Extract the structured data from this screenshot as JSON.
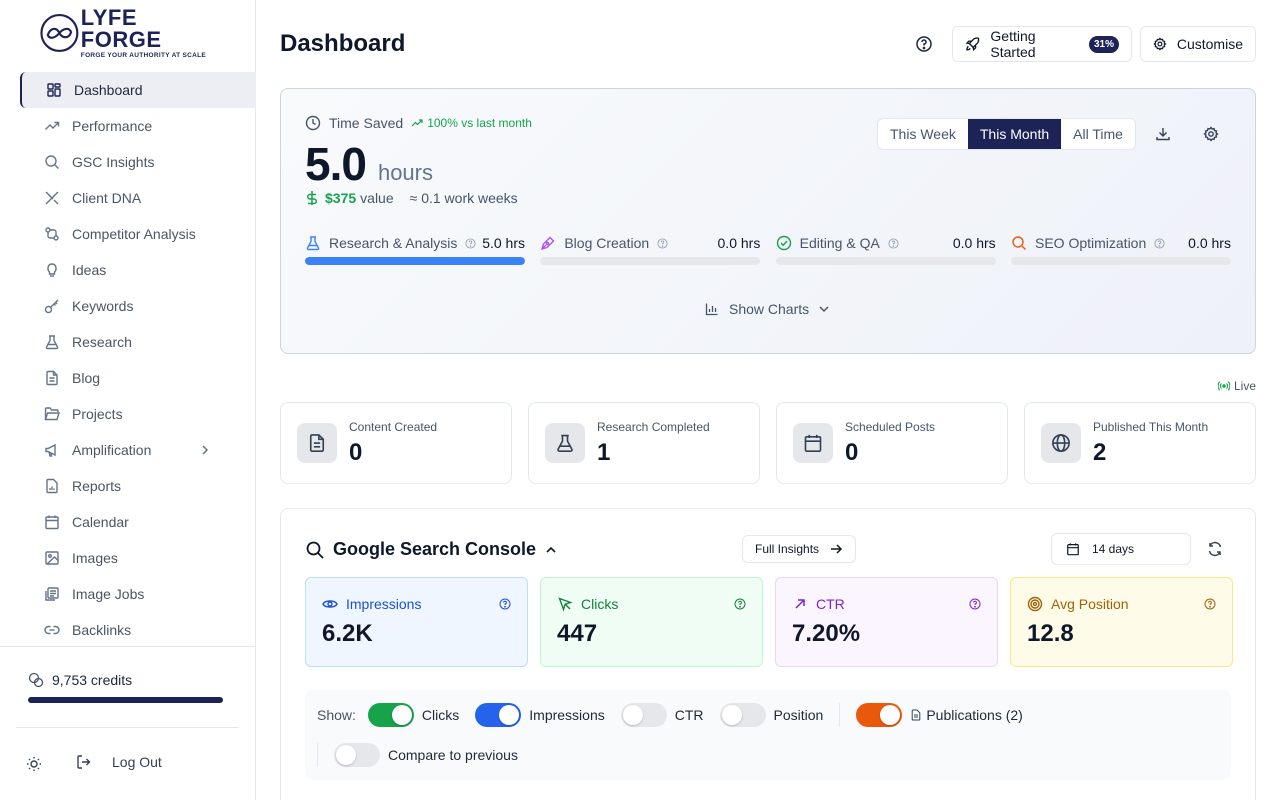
{
  "brand": {
    "name": "LYFE FORGE",
    "tagline": "FORGE YOUR AUTHORITY AT SCALE"
  },
  "sidebar": {
    "items": [
      {
        "label": "Dashboard",
        "icon": "dashboard-icon",
        "active": true
      },
      {
        "label": "Performance",
        "icon": "trend-icon"
      },
      {
        "label": "GSC Insights",
        "icon": "search-icon"
      },
      {
        "label": "Client DNA",
        "icon": "dna-icon"
      },
      {
        "label": "Competitor Analysis",
        "icon": "network-icon"
      },
      {
        "label": "Ideas",
        "icon": "lightbulb-icon"
      },
      {
        "label": "Keywords",
        "icon": "key-icon"
      },
      {
        "label": "Research",
        "icon": "flask-icon"
      },
      {
        "label": "Blog",
        "icon": "document-icon"
      },
      {
        "label": "Projects",
        "icon": "folder-icon"
      },
      {
        "label": "Amplification",
        "icon": "megaphone-icon",
        "has_submenu": true
      },
      {
        "label": "Reports",
        "icon": "report-icon"
      },
      {
        "label": "Calendar",
        "icon": "calendar-icon"
      },
      {
        "label": "Images",
        "icon": "image-icon"
      },
      {
        "label": "Image Jobs",
        "icon": "image-jobs-icon"
      },
      {
        "label": "Backlinks",
        "icon": "link-icon"
      }
    ],
    "credits_label": "9,753 credits",
    "credits_fill": 1.0,
    "logout_label": "Log Out"
  },
  "header": {
    "title": "Dashboard",
    "getting_started_label": "Getting Started",
    "getting_started_badge": "31%",
    "customise_label": "Customise"
  },
  "time_saved": {
    "label": "Time Saved",
    "trend": "100% vs last month",
    "value": "5.0",
    "unit": "hours",
    "money": "$375",
    "money_suffix": "value",
    "weeks": "≈ 0.1 work weeks",
    "periods": [
      "This Week",
      "This Month",
      "All Time"
    ],
    "active_period": "This Month",
    "categories": [
      {
        "label": "Research & Analysis",
        "value": "5.0 hrs",
        "fill": 1.0,
        "icon": "flask-icon",
        "color": "#3b82f6"
      },
      {
        "label": "Blog Creation",
        "value": "0.0 hrs",
        "fill": 0,
        "icon": "pen-icon",
        "color": "#a855f7"
      },
      {
        "label": "Editing & QA",
        "value": "0.0 hrs",
        "fill": 0,
        "icon": "check-circle-icon",
        "color": "#16a34a"
      },
      {
        "label": "SEO Optimization",
        "value": "0.0 hrs",
        "fill": 0,
        "icon": "search-icon",
        "color": "#ea580c"
      }
    ],
    "show_charts_label": "Show Charts"
  },
  "live_label": "Live",
  "stats": [
    {
      "label": "Content Created",
      "value": "0",
      "icon": "document-icon"
    },
    {
      "label": "Research Completed",
      "value": "1",
      "icon": "flask-icon"
    },
    {
      "label": "Scheduled Posts",
      "value": "0",
      "icon": "calendar-icon"
    },
    {
      "label": "Published This Month",
      "value": "2",
      "icon": "globe-icon"
    }
  ],
  "gsc": {
    "title": "Google Search Console",
    "full_insights_label": "Full Insights",
    "range_label": "14 days",
    "metrics": [
      {
        "label": "Impressions",
        "value": "6.2K",
        "icon": "eye-icon",
        "color": "#1d4ed8",
        "bg": "#eff6ff",
        "border": "#bfdbfe"
      },
      {
        "label": "Clicks",
        "value": "447",
        "icon": "cursor-icon",
        "color": "#15803d",
        "bg": "#f0fdf4",
        "border": "#bbf7d0"
      },
      {
        "label": "CTR",
        "value": "7.20%",
        "icon": "arrow-up-right-icon",
        "color": "#7e22ce",
        "bg": "#faf5ff",
        "border": "#e9d5ff"
      },
      {
        "label": "Avg Position",
        "value": "12.8",
        "icon": "target-icon",
        "color": "#a16207",
        "bg": "#fefce8",
        "border": "#fde68a"
      }
    ],
    "show_label": "Show:",
    "toggles": [
      {
        "label": "Clicks",
        "on": true,
        "color": "#16a34a"
      },
      {
        "label": "Impressions",
        "on": true,
        "color": "#2563eb"
      },
      {
        "label": "CTR",
        "on": false
      },
      {
        "label": "Position",
        "on": false
      }
    ],
    "publications_label": "Publications (2)",
    "publications_on": true,
    "publications_color": "#ea580c",
    "compare_label": "Compare to previous",
    "compare_on": false
  }
}
